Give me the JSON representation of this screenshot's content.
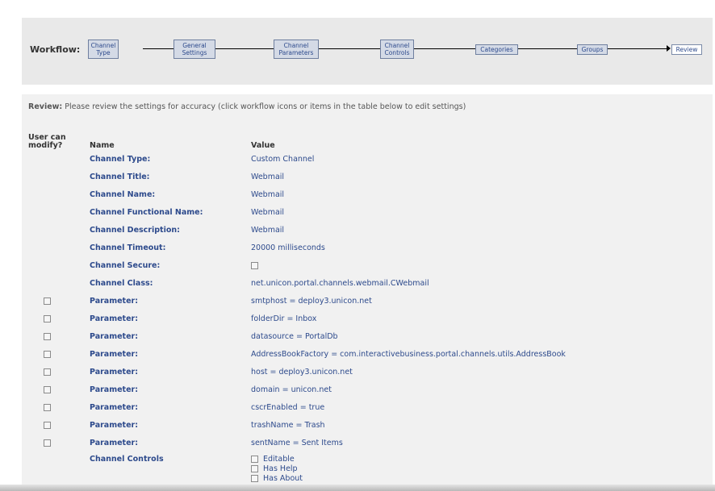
{
  "workflow": {
    "label": "Workflow:",
    "steps": [
      {
        "label": "Channel\nType"
      },
      {
        "label": "General\nSettings"
      },
      {
        "label": "Channel\nParameters"
      },
      {
        "label": "Channel\nControls"
      },
      {
        "label": "Categories"
      },
      {
        "label": "Groups"
      },
      {
        "label": "Review",
        "current": true
      }
    ]
  },
  "review": {
    "note_label": "Review:",
    "note_text": " Please review the settings for accuracy (click workflow icons or items in the table below to edit settings)",
    "headers": {
      "modify": "User can\nmodify?",
      "name": "Name",
      "value": "Value"
    },
    "rows": [
      {
        "modify_checkbox": false,
        "name": "Channel Type:",
        "value": "Custom Channel"
      },
      {
        "modify_checkbox": false,
        "name": "Channel Title:",
        "value": "Webmail"
      },
      {
        "modify_checkbox": false,
        "name": "Channel Name:",
        "value": "Webmail"
      },
      {
        "modify_checkbox": false,
        "name": "Channel Functional Name:",
        "value": "Webmail"
      },
      {
        "modify_checkbox": false,
        "name": "Channel Description:",
        "value": "Webmail"
      },
      {
        "modify_checkbox": false,
        "name": "Channel Timeout:",
        "value": "20000 milliseconds"
      },
      {
        "modify_checkbox": false,
        "name": "Channel Secure:",
        "value": "",
        "value_checkbox": true
      },
      {
        "modify_checkbox": false,
        "name": "Channel Class:",
        "value": "net.unicon.portal.channels.webmail.CWebmail"
      },
      {
        "modify_checkbox": true,
        "name": "Parameter:",
        "value": "smtphost = deploy3.unicon.net"
      },
      {
        "modify_checkbox": true,
        "name": "Parameter:",
        "value": "folderDir = Inbox"
      },
      {
        "modify_checkbox": true,
        "name": "Parameter:",
        "value": "datasource = PortalDb"
      },
      {
        "modify_checkbox": true,
        "name": "Parameter:",
        "value": "AddressBookFactory = com.interactivebusiness.portal.channels.utils.AddressBook"
      },
      {
        "modify_checkbox": true,
        "name": "Parameter:",
        "value": "host = deploy3.unicon.net"
      },
      {
        "modify_checkbox": true,
        "name": "Parameter:",
        "value": "domain = unicon.net"
      },
      {
        "modify_checkbox": true,
        "name": "Parameter:",
        "value": "cscrEnabled = true"
      },
      {
        "modify_checkbox": true,
        "name": "Parameter:",
        "value": "trashName = Trash"
      },
      {
        "modify_checkbox": true,
        "name": "Parameter:",
        "value": "sentName = Sent Items"
      }
    ],
    "controls": {
      "name": "Channel Controls",
      "items": [
        {
          "label": "Editable"
        },
        {
          "label": "Has Help"
        },
        {
          "label": "Has About"
        }
      ]
    }
  }
}
